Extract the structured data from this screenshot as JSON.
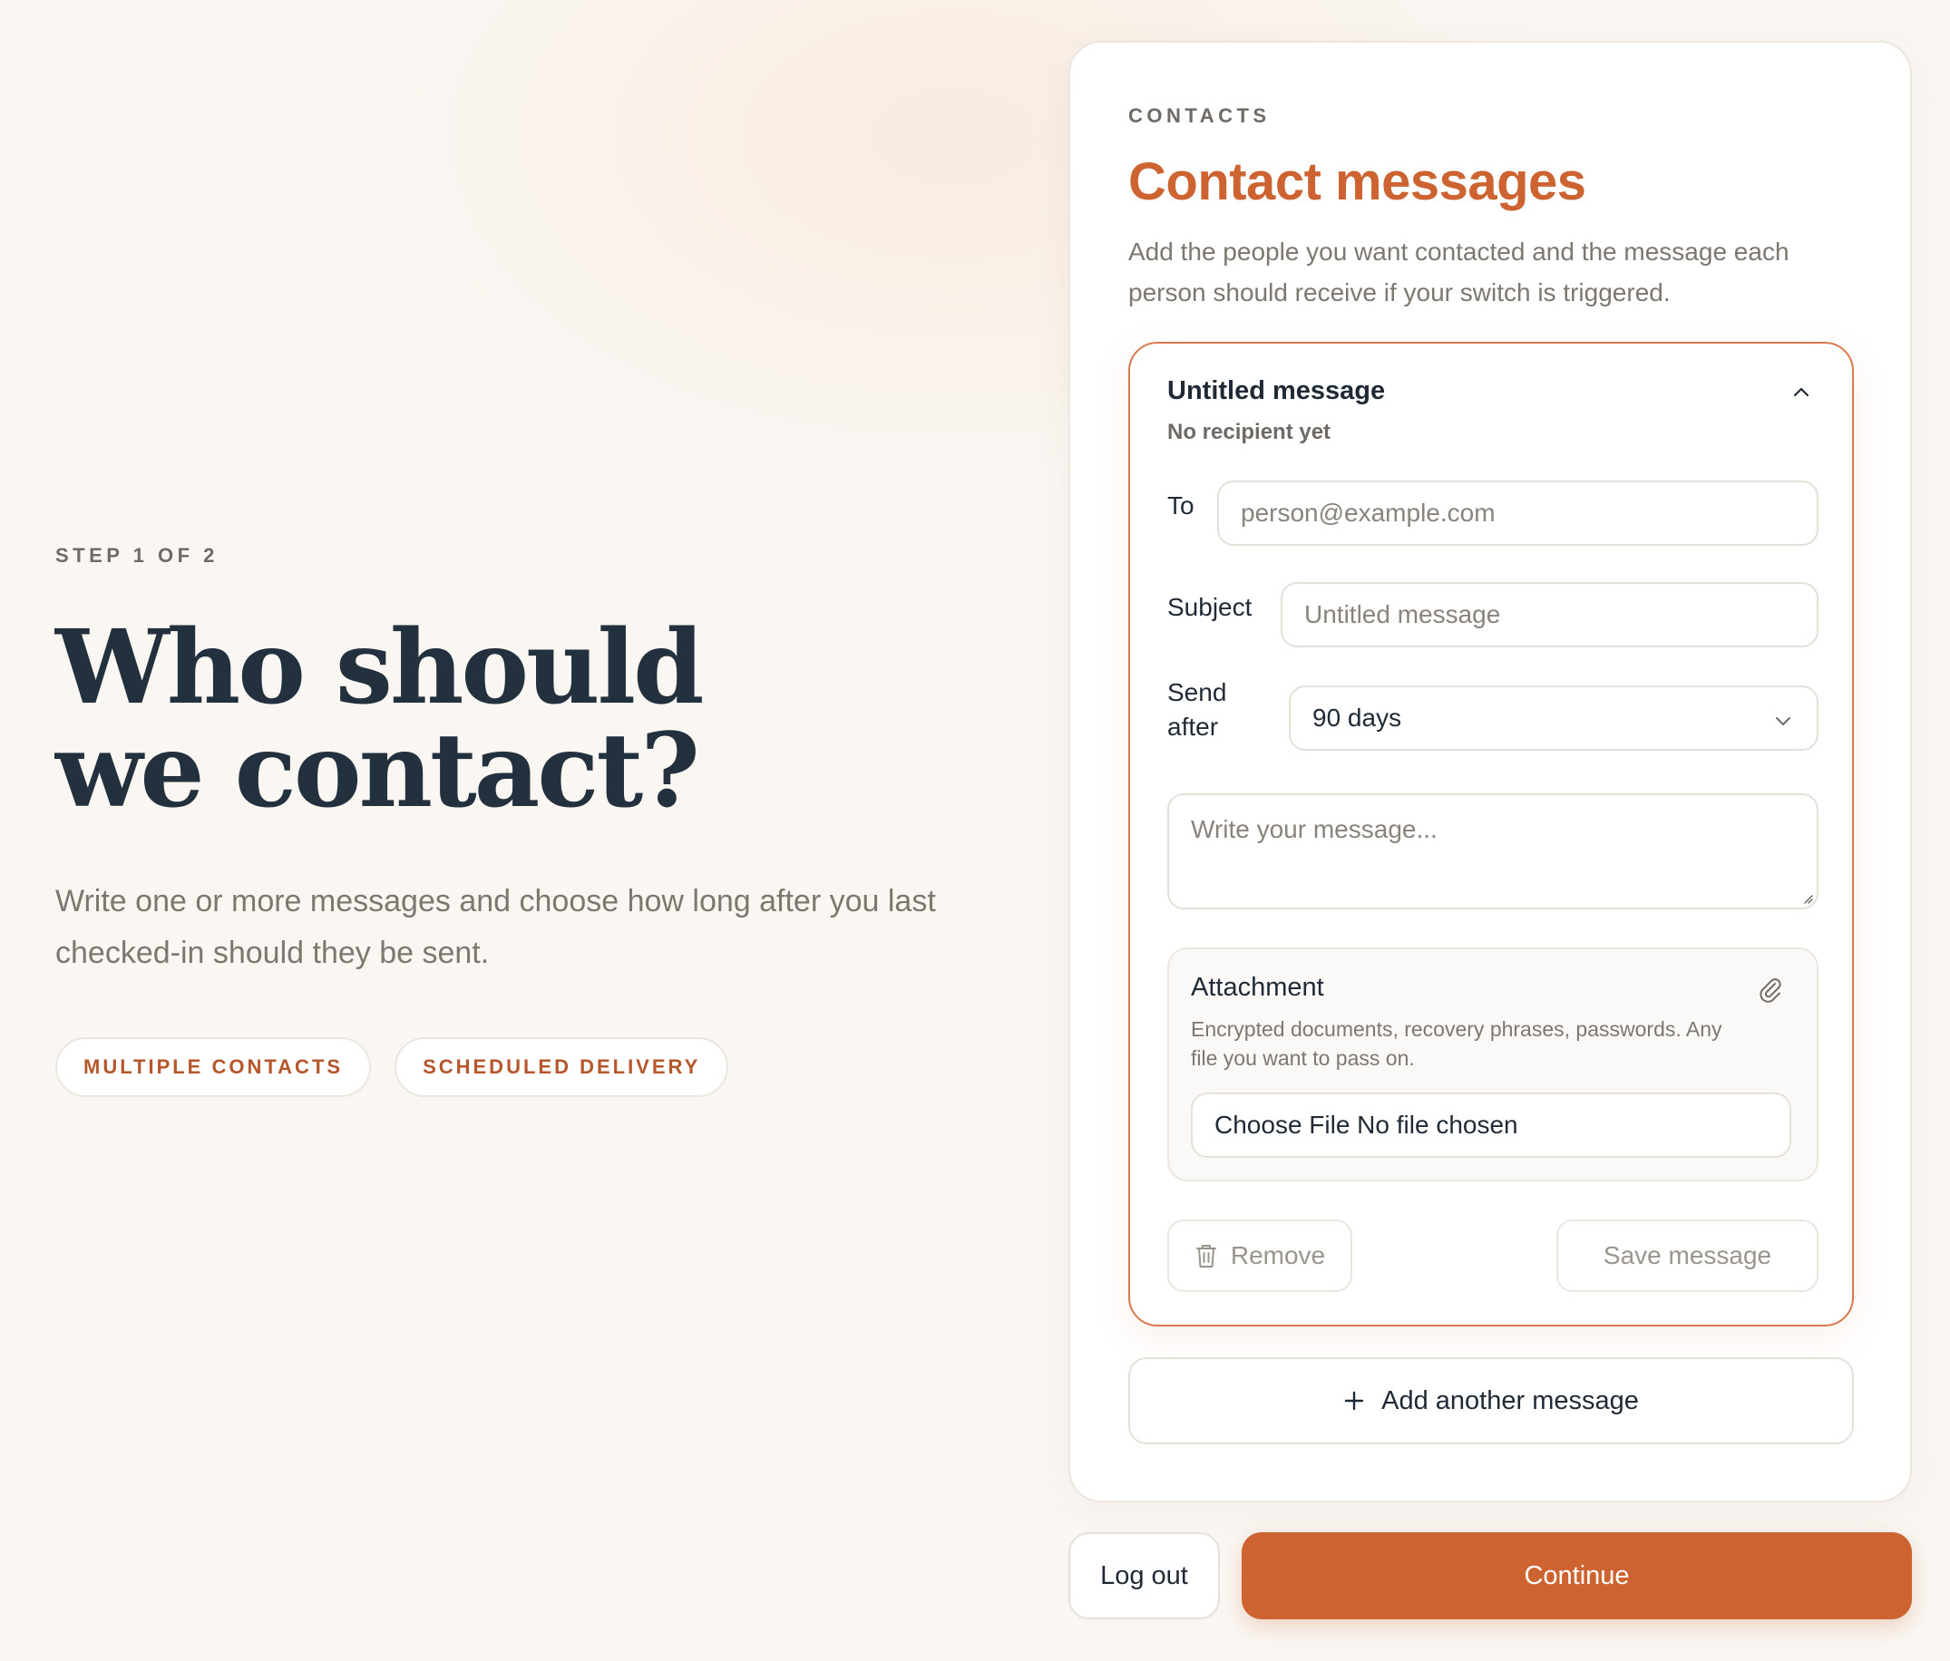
{
  "intro": {
    "step": "STEP 1 OF 2",
    "headline_line1": "Who should",
    "headline_line2": "we contact?",
    "lead": "Write one or more messages and choose how long after you last checked-in should they be sent.",
    "chips": [
      "MULTIPLE CONTACTS",
      "SCHEDULED DELIVERY"
    ]
  },
  "panel": {
    "eyebrow": "CONTACTS",
    "title": "Contact messages",
    "description": "Add the people you want contacted and the message each person should receive if your switch is triggered."
  },
  "message_card": {
    "title": "Untitled message",
    "subtitle": "No recipient yet",
    "to_label": "To",
    "to_placeholder": "person@example.com",
    "subject_label": "Subject",
    "subject_placeholder": "Untitled message",
    "send_after_label_line1": "Send",
    "send_after_label_line2": "after",
    "send_after_value": "90 days",
    "message_placeholder": "Write your message...",
    "attachment": {
      "title": "Attachment",
      "description": "Encrypted documents, recovery phrases, passwords. Any file you want to pass on.",
      "file_label": "Choose File No file chosen"
    },
    "remove_label": "Remove",
    "save_label": "Save message"
  },
  "add_another_label": "Add another message",
  "footer": {
    "logout_label": "Log out",
    "continue_label": "Continue"
  },
  "colors": {
    "accent": "#cc6331",
    "background": "#faf7f3",
    "text": "#1f2a36"
  },
  "icons": [
    "chevron-up-icon",
    "chevron-down-icon",
    "resize-grip-icon",
    "paperclip-icon",
    "trash-icon",
    "plus-icon"
  ]
}
